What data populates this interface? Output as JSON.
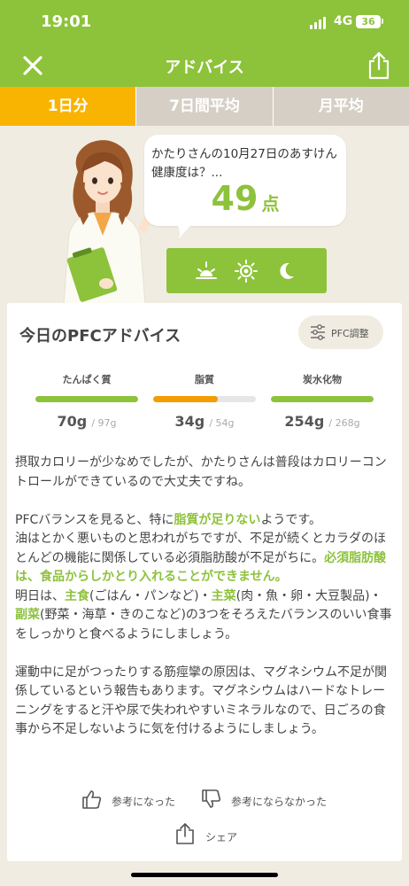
{
  "status_bar": {
    "time": "19:01",
    "network": "4G",
    "battery": "36"
  },
  "nav": {
    "title": "アドバイス",
    "close_icon": "close-icon",
    "share_icon": "share-icon"
  },
  "tabs": [
    {
      "label": "1日分",
      "active": true
    },
    {
      "label": "7日間平均",
      "active": false
    },
    {
      "label": "月平均",
      "active": false
    }
  ],
  "hero": {
    "question": "かたりさんの10月27日のあすけん健康度は？...",
    "score": "49",
    "score_unit": "点",
    "time_icons": [
      "sunrise-icon",
      "sun-icon",
      "moon-icon"
    ]
  },
  "card": {
    "title": "今日のPFCアドバイス",
    "pfc_button": "PFC調整",
    "nutrients": [
      {
        "label": "たんぱく質",
        "value": "70g",
        "target": "/ 97g",
        "fill": 1.0,
        "color": "#8dc23b"
      },
      {
        "label": "脂質",
        "value": "34g",
        "target": "/ 54g",
        "fill": 0.63,
        "color": "#f49c00"
      },
      {
        "label": "炭水化物",
        "value": "254g",
        "target": "/ 268g",
        "fill": 1.0,
        "color": "#8dc23b"
      }
    ],
    "advice": {
      "p1": "摂取カロリーが少なめでしたが、かたりさんは普段はカロリーコントロールができているので大丈夫ですね。",
      "p2a": "PFCバランスを見ると、特に",
      "p2b": "脂質が足りない",
      "p2c": "ようです。",
      "p2d": "油はとかく悪いものと思われがちですが、不足が続くとカラダのほとんどの機能に関係している必須脂肪酸が不足がちに。",
      "p2e": "必須脂肪酸は、食品からしかとり入れることができません。",
      "p2f": "明日は、",
      "p2g": "主食",
      "p2h": "(ごはん・パンなど)・",
      "p2i": "主菜",
      "p2j": "(肉・魚・卵・大豆製品)・",
      "p2k": "副菜",
      "p2l": "(野菜・海草・きのこなど)の3つをそろえたバランスのいい食事をしっかりと食べるようにしましょう。",
      "p3": "運動中に足がつったりする筋痙攣の原因は、マグネシウム不足が関係しているという報告もあります。マグネシウムはハードなトレーニングをすると汗や尿で失われやすいミネラルなので、日ごろの食事から不足しないように気を付けるようにしましょう。"
    },
    "feedback": {
      "helpful": "参考になった",
      "not_helpful": "参考にならなかった",
      "share": "シェア"
    }
  },
  "colors": {
    "brand_green": "#8dc23b",
    "tab_active": "#f8b400",
    "fat_orange": "#f49c00",
    "background": "#f1ece2"
  }
}
